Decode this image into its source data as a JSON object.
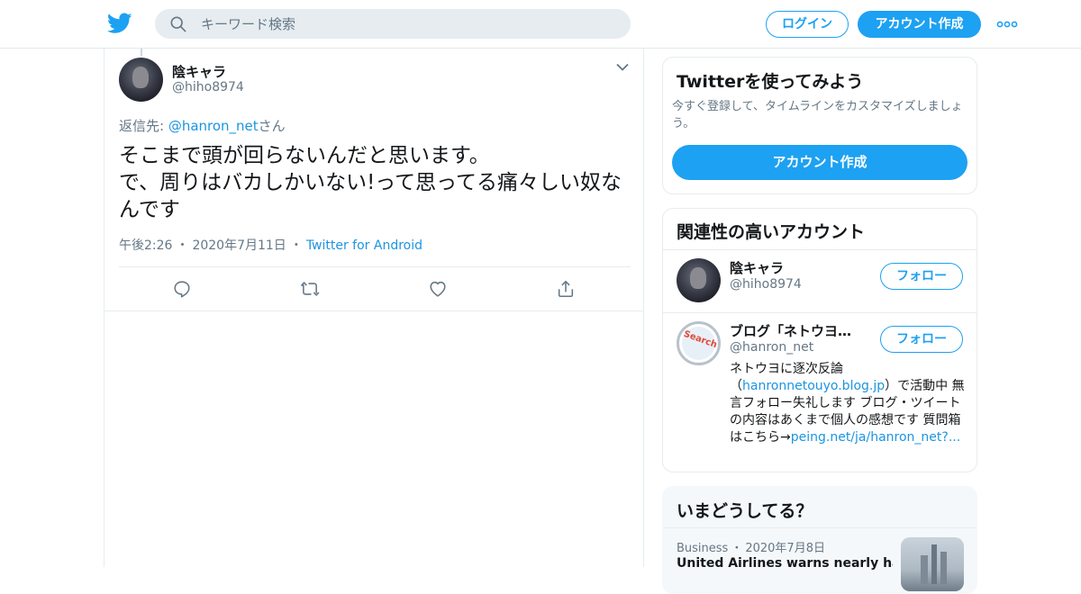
{
  "header": {
    "search_placeholder": "キーワード検索",
    "login_label": "ログイン",
    "signup_label": "アカウント作成",
    "brand_color": "#1da1f2"
  },
  "tweet": {
    "author_name": "陰キャラ",
    "author_handle": "@hiho8974",
    "reply_prefix": "返信先: ",
    "reply_handle": "@hanron_net",
    "reply_suffix": "さん",
    "text_line1": "そこまで頭が回らないんだと思います。",
    "text_line2": "で、周りはバカしかいない!って思ってる痛々しい奴なんです",
    "time": "午後2:26",
    "date": "2020年7月11日",
    "source": "Twitter for Android",
    "separator": "・"
  },
  "sidebar": {
    "signup_card": {
      "title": "Twitterを使ってみよう",
      "description": "今すぐ登録して、タイムラインをカスタマイズしましょう。",
      "button_label": "アカウント作成"
    },
    "related": {
      "title": "関連性の高いアカウント",
      "accounts": [
        {
          "name": "陰キャラ",
          "handle": "@hiho8974",
          "follow_label": "フォロー"
        },
        {
          "name": "ブログ「ネトウヨに逐次反論」",
          "handle": "@hanron_net",
          "follow_label": "フォロー",
          "bio_part1": "ネトウヨに逐次反論（",
          "bio_link1": "hanronnetouyo.blog.jp",
          "bio_part2": "）で活動中 無言フォロー失礼します ブログ・ツイートの内容はあくまで個人の感想です 質問箱はこちら→",
          "bio_link2": "peing.net/ja/hanron_net?...",
          "avatar_text": "Search"
        }
      ]
    },
    "trends": {
      "title": "いまどうしてる？",
      "items": [
        {
          "category": "Business",
          "date": "2020年7月8日",
          "headline": "United Airlines warns nearly half its"
        }
      ]
    }
  }
}
